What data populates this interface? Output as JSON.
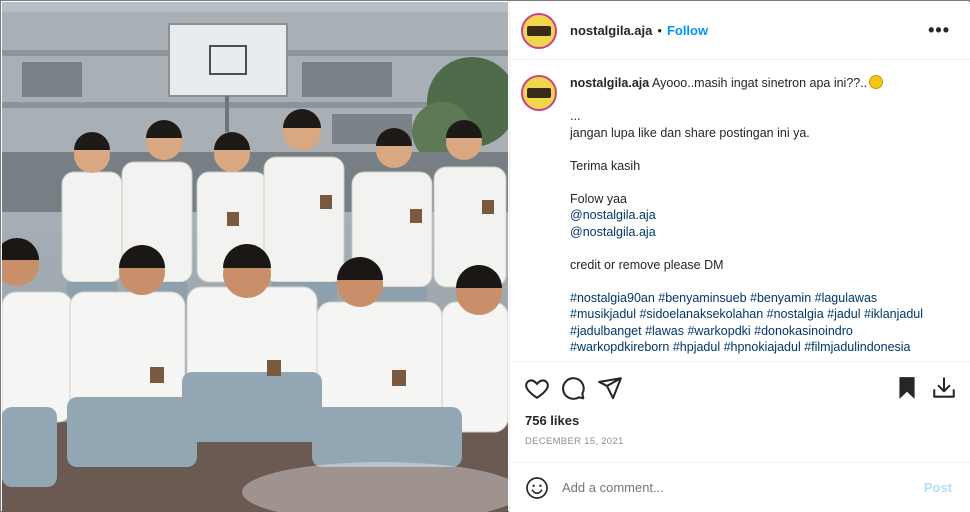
{
  "post": {
    "username": "nostalgila.aja",
    "separator": "•",
    "follow_label": "Follow",
    "more_label": "•••",
    "caption": {
      "username": "nostalgila.aja",
      "first_line": "Ayooo..masih ingat sinetron apa ini??..",
      "lines": [
        "...",
        "jangan lupa like dan share postingan ini ya.",
        "",
        "Terima kasih",
        "",
        "Folow yaa",
        "@nostalgila.aja",
        "@nostalgila.aja",
        "",
        "credit or remove please DM",
        ""
      ],
      "hashtag_lines": [
        "#nostalgia90an #benyaminsueb #benyamin #lagulawas",
        "#musikjadul #sidoelanaksekolahan #nostalgia #jadul #iklanjadul",
        "#jadulbanget #lawas #warkopdki #donokasinoindro",
        "#warkopdkireborn #hpjadul #hpnokiajadul #filmjadulindonesia"
      ]
    },
    "likes": "756 likes",
    "date": "DECEMBER 15, 2021",
    "comment_placeholder": "Add a comment...",
    "post_label": "Post",
    "icons": [
      "heart-icon",
      "comment-icon",
      "share-icon",
      "bookmark-icon",
      "download-icon",
      "emoji-icon"
    ]
  }
}
